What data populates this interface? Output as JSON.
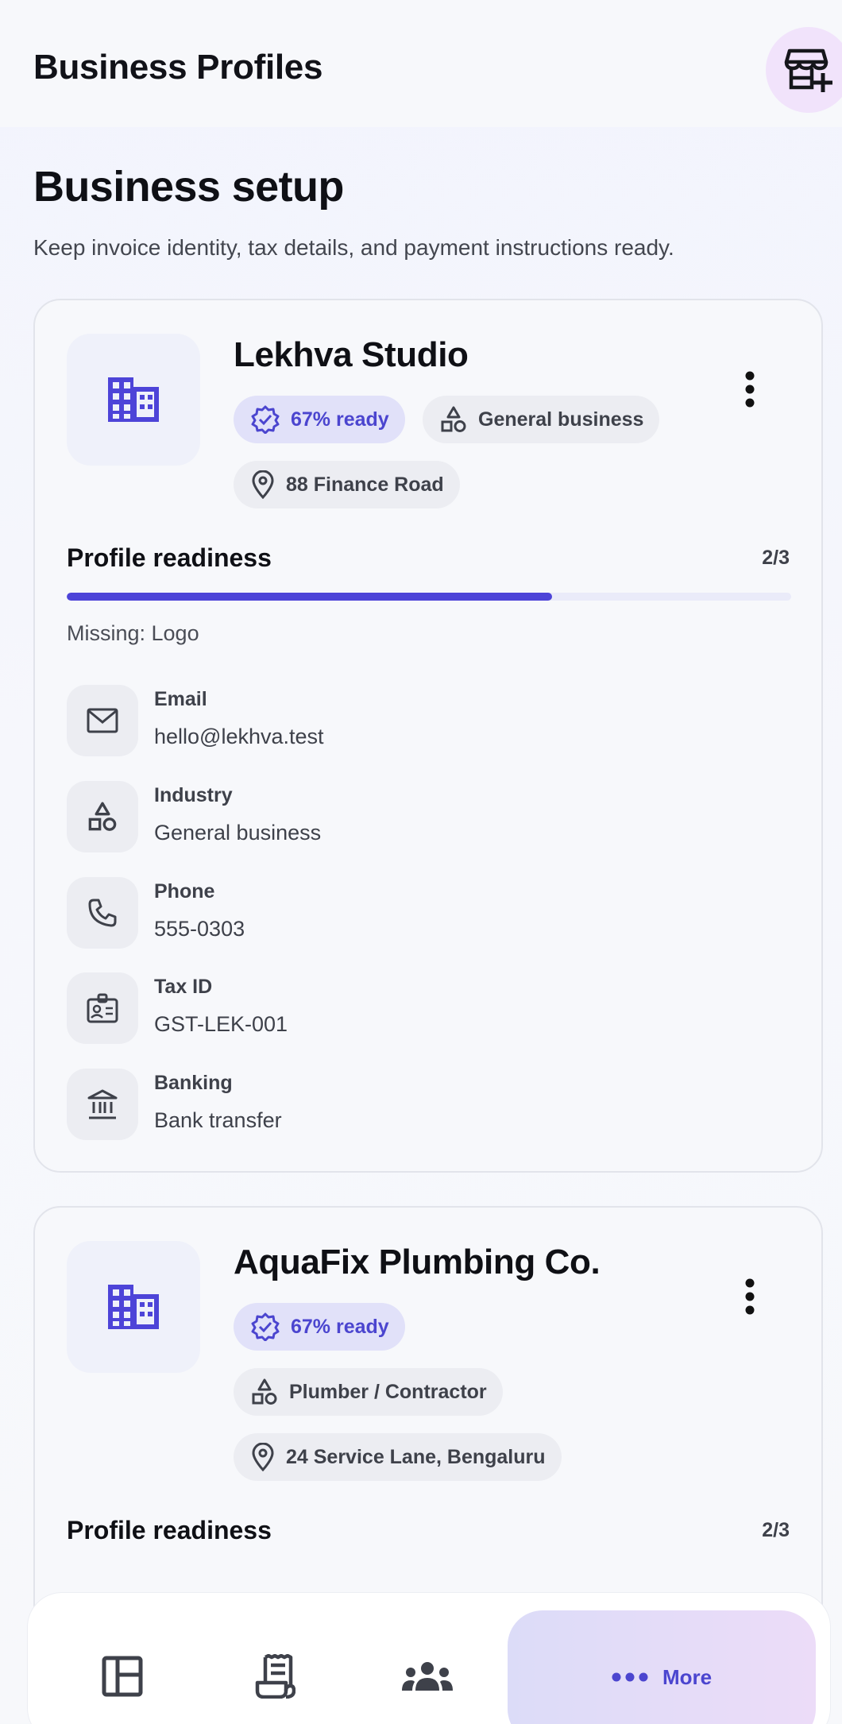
{
  "appbar": {
    "title": "Business Profiles"
  },
  "page": {
    "heading": "Business setup",
    "subtitle": "Keep invoice identity, tax details, and payment instructions ready."
  },
  "profiles": [
    {
      "name": "Lekhva Studio",
      "ready_label": "67% ready",
      "ready_fraction": 0.67,
      "industry": "General business",
      "address": "88 Finance Road",
      "readiness_title": "Profile readiness",
      "readiness_count": "2/3",
      "missing": "Missing: Logo",
      "details": [
        {
          "label": "Email",
          "value": "hello@lekhva.test",
          "icon": "mail-icon"
        },
        {
          "label": "Industry",
          "value": "General business",
          "icon": "shapes-icon"
        },
        {
          "label": "Phone",
          "value": "555-0303",
          "icon": "phone-icon"
        },
        {
          "label": "Tax ID",
          "value": "GST-LEK-001",
          "icon": "id-card-icon"
        },
        {
          "label": "Banking",
          "value": "Bank transfer",
          "icon": "bank-icon"
        }
      ]
    },
    {
      "name": "AquaFix Plumbing Co.",
      "ready_label": "67% ready",
      "industry": "Plumber / Contractor",
      "address": "24 Service Lane, Bengaluru",
      "readiness_title": "Profile readiness",
      "readiness_count": "2/3"
    }
  ],
  "nav": {
    "items": [
      {
        "icon": "dashboard-icon"
      },
      {
        "icon": "receipt-icon"
      },
      {
        "icon": "groups-icon"
      }
    ],
    "more_label": "More"
  },
  "colors": {
    "accent": "#4d44d8",
    "ready_chip_bg": "#e1e1f9",
    "chip_bg": "#ecedf2",
    "add_button_bg": "#f1e3fb"
  }
}
